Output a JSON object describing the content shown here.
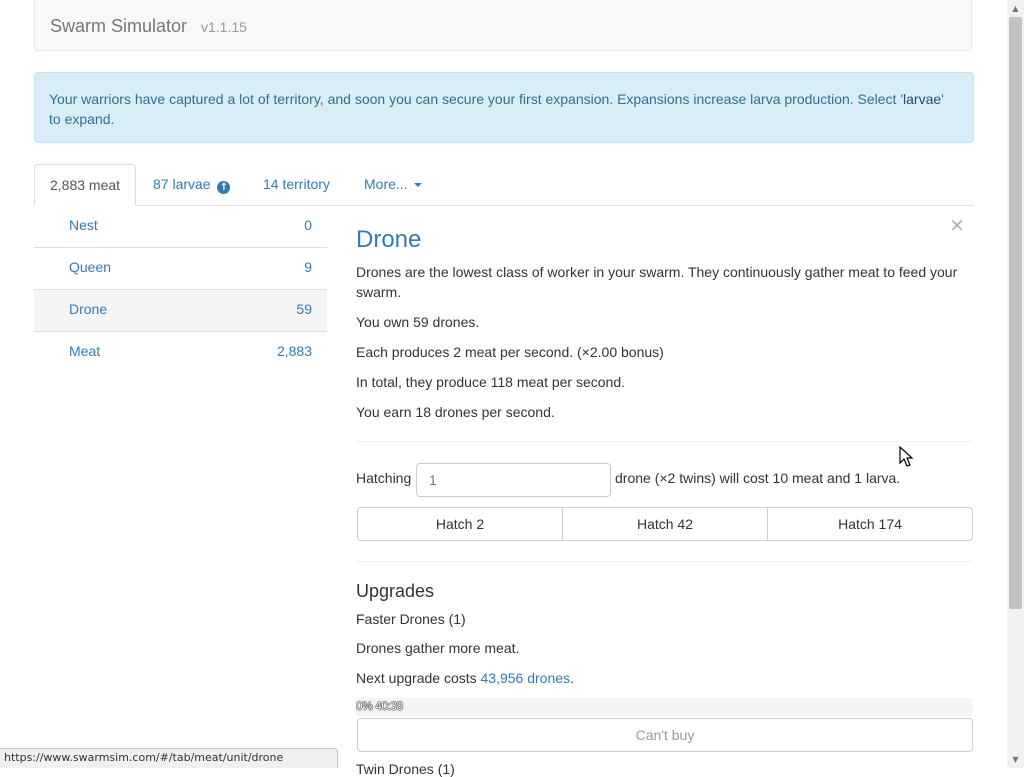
{
  "navbar": {
    "brand": "Swarm Simulator",
    "version": "v1.1.15"
  },
  "alert": {
    "text_before": "Your warriors have captured a lot of territory, and soon you can secure your first expansion. Expansions increase larva production. Select '",
    "highlight": "larvae",
    "text_after": "' to expand."
  },
  "tabs": [
    {
      "label": "2,883 meat",
      "active": true
    },
    {
      "label": "87 larvae",
      "icon": "arrow-up-circle-icon"
    },
    {
      "label": "14 territory"
    },
    {
      "label": "More...",
      "icon": "caret-down-icon"
    }
  ],
  "units": [
    {
      "name": "Nest",
      "count": "0"
    },
    {
      "name": "Queen",
      "count": "9"
    },
    {
      "name": "Drone",
      "count": "59",
      "active": true
    },
    {
      "name": "Meat",
      "count": "2,883"
    }
  ],
  "detail": {
    "close": "×",
    "title": "Drone",
    "description": "Drones are the lowest class of worker in your swarm. They continuously gather meat to feed your swarm.",
    "own": "You own 59 drones.",
    "produces": "Each produces 2 meat per second. (×2.00 bonus)",
    "total": "In total, they produce 118 meat per second.",
    "earn": "You earn 18 drones per second.",
    "hatch_label": "Hatching",
    "hatch_placeholder": "1",
    "hatch_rest": "drone (×2 twins) will cost 10 meat and 1 larva.",
    "hatch_buttons": [
      "Hatch 2",
      "Hatch 42",
      "Hatch 174"
    ]
  },
  "upgrades": {
    "heading": "Upgrades",
    "name": "Faster Drones (1)",
    "desc": "Drones gather more meat.",
    "cost_prefix": "Next upgrade costs ",
    "cost_link": "43,956 drones",
    "cost_suffix": ".",
    "progress_text": "0% 40:38",
    "progress_percent": 0,
    "cant_buy": "Can't buy",
    "next_name": "Twin Drones (1)"
  },
  "statusbar": {
    "url": "https://www.swarmsim.com/#/tab/meat/unit/drone"
  },
  "colors": {
    "link": "#337ab7",
    "alert_bg": "#d9edf7",
    "alert_text": "#31708f"
  }
}
